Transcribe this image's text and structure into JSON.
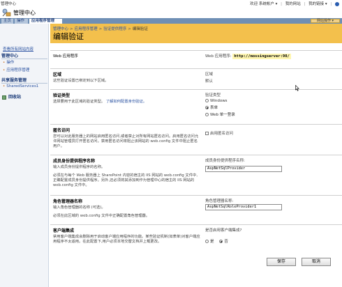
{
  "topbar": {
    "site_name": "管理中心",
    "welcome": "欢迎 系统帐户 ▾",
    "my_site": "我的网站",
    "my_links": "我的链接 ▾",
    "sep": "|"
  },
  "app": {
    "title": "管理中心"
  },
  "tabs": [
    {
      "label": "主页"
    },
    {
      "label": "操作"
    },
    {
      "label": "应用程序管理"
    }
  ],
  "site_actions": {
    "label": "网站操作 ▾"
  },
  "breadcrumb": {
    "items": [
      "管理中心",
      "应用程序管理",
      "验证提供程序",
      "编辑验证"
    ],
    "separator": ">"
  },
  "page_title": "编辑验证",
  "leftnav": {
    "view_all": "查看所有网站内容",
    "sections": [
      {
        "title": "管理中心",
        "items": [
          "操作",
          "应用程序管理"
        ]
      },
      {
        "title": "共享服务管理",
        "items": [
          "SharedServices1"
        ]
      }
    ],
    "recycle_bin": "回收站"
  },
  "form": {
    "web_app": {
      "label": "Web 应用程序",
      "right_label": "Web 应用程序:",
      "value": "http://mossingserver:90/"
    },
    "zone": {
      "title": "区域",
      "desc": "这些验证设置已绑定到以下区域。",
      "right_label": "区域",
      "right_value": "默认"
    },
    "auth_type": {
      "title": "验证类型",
      "desc": "选择要用于此区域的验证类型。",
      "link": "了解如何配置身份验证。",
      "right_label": "验证类型",
      "options": [
        "Windows",
        "表单",
        "Web 单一登录"
      ],
      "selected": 1
    },
    "anonymous": {
      "title": "匿名访问",
      "desc": "您可以对此服务器上的网站启用匿名访问,或者禁止对所有网站匿名访问。启用匿名访问允许网站管理员打开匿名访问。禁用匿名访问将阻止该网站的 web.config 文件中阻止匿名用户。",
      "checkbox_label": "启用匿名访问"
    },
    "membership": {
      "title": "成员身份提供程序名称",
      "desc1": "输入成员身份提供程序的名称。",
      "desc2": "必须在与每个 Web 服务器上 SharePoint 内容的宿主的 IIS 网站的 web.config 文件中,正确配置成员身份提供程序。另外,还必须将其添加到作为管理中心的宿主的 IIS 网站的 web.config 文件中。",
      "right_label": "成员身份提供程序名称:",
      "value": "AspNetSqlProvider"
    },
    "role_manager": {
      "title": "角色管理器名称",
      "desc1": "输入角色管理器的名称 (可选)。",
      "desc2": "必须在此区域的 web.config 文件中正确配置角色管理器。",
      "right_label": "角色管理器名称:",
      "value": "AspNetSqlRoleProvider1"
    },
    "client_integration": {
      "title": "客户端集成",
      "desc": "禁用客户端集成会删除用于启动客户端应用程序的功能。某些验证机制(如表单)对客户端应用程序不太适用。在此配置下,用户必须本地交替文档并上载更改。",
      "right_label": "是否启用客户端集成?",
      "options": [
        "是",
        "否"
      ],
      "selected": 1
    }
  },
  "buttons": {
    "save": "保存",
    "cancel": "取消"
  }
}
